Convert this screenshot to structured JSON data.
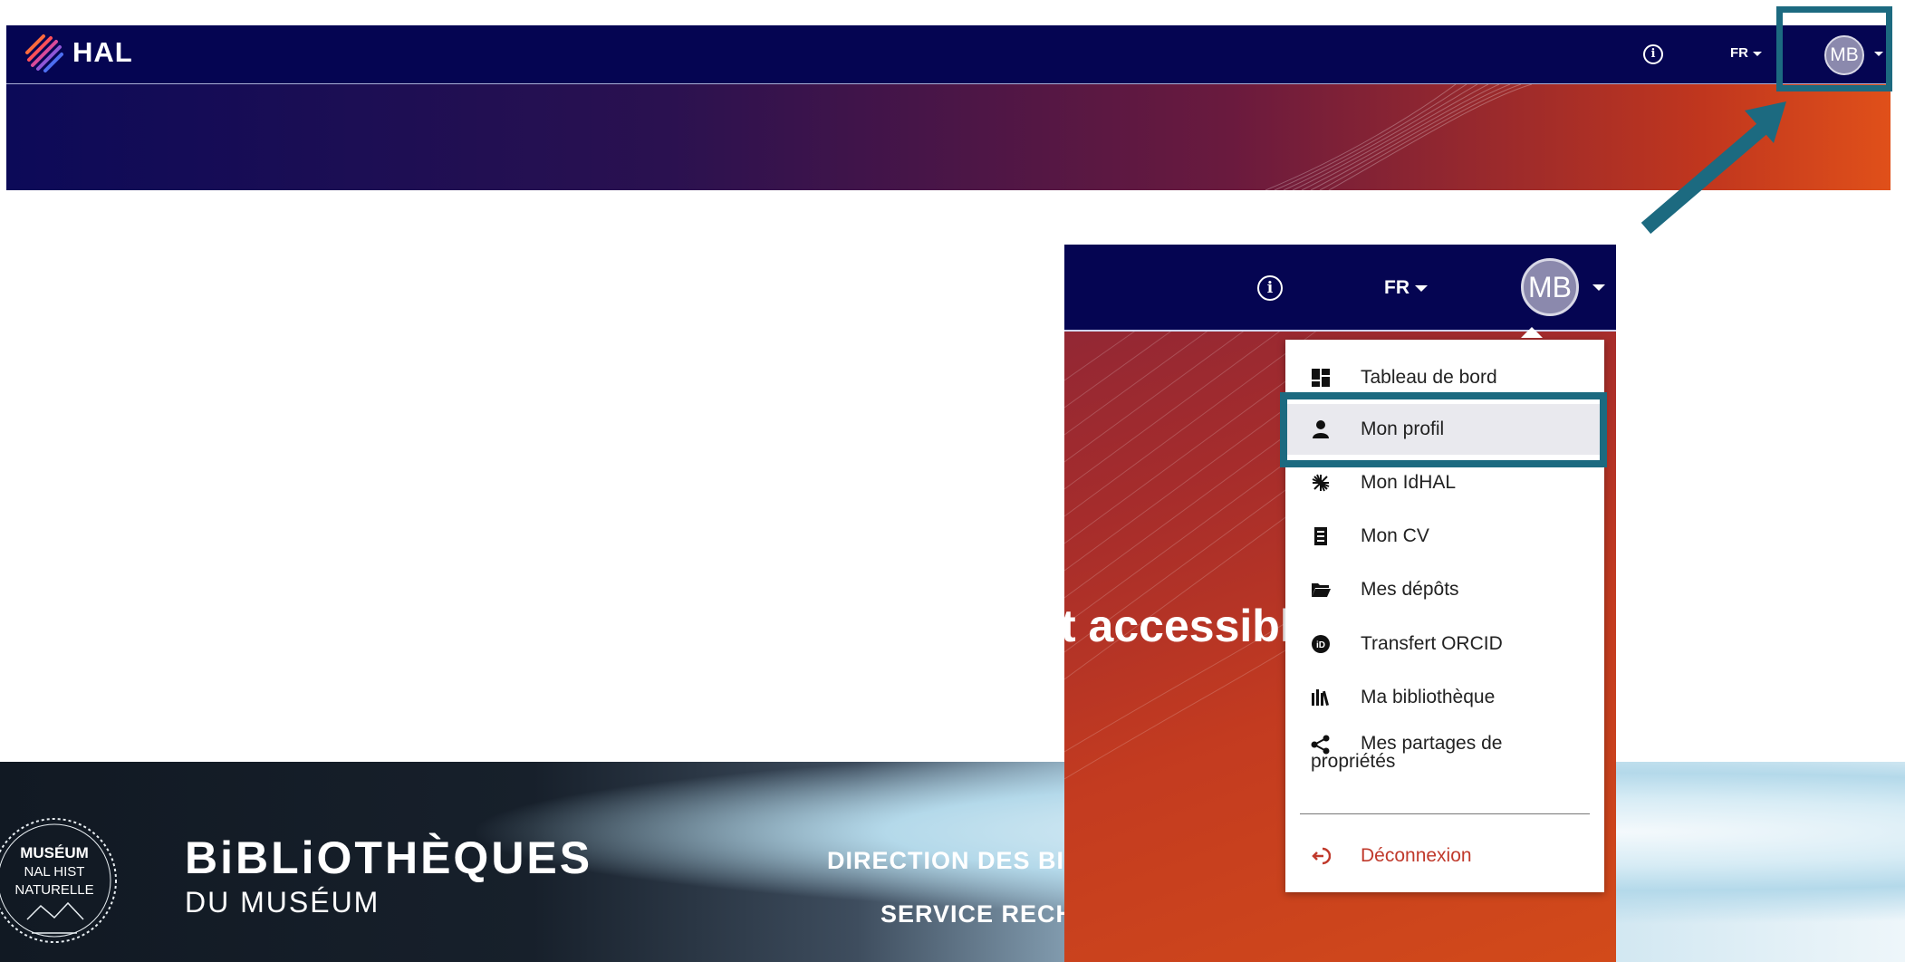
{
  "header": {
    "logo_text": "HAL",
    "lang_label": "FR",
    "user_initials": "MB"
  },
  "dropdown": {
    "items": [
      {
        "label": "Tableau de bord",
        "icon": "dashboard-icon"
      },
      {
        "label": "Mon profil",
        "icon": "user-icon"
      },
      {
        "label": "Mon IdHAL",
        "icon": "idhal-icon"
      },
      {
        "label": "Mon CV",
        "icon": "cv-icon"
      },
      {
        "label": "Mes dépôts",
        "icon": "folder-icon"
      },
      {
        "label": "Transfert ORCID",
        "icon": "orcid-icon"
      },
      {
        "label": "Ma bibliothèque",
        "icon": "library-icon"
      },
      {
        "label": "Mes partages de propriétés",
        "icon": "share-icon"
      }
    ],
    "logout_label": "Déconnexion",
    "active_item": "Mon profil"
  },
  "hero_fragment": "t accessibl",
  "footer": {
    "seal_lines": [
      "MUSÉUM",
      "NAL HIST",
      "NATURELLE"
    ],
    "library_title": "BiBLiOTHÈQUES",
    "library_subtitle": "DU MUSÉUM",
    "direction_text": "DIRECTION DES BI",
    "service_text": "SERVICE RECH"
  },
  "colors": {
    "navbar": "#050552",
    "highlight": "#1c6a80",
    "logout": "#c0392b"
  }
}
